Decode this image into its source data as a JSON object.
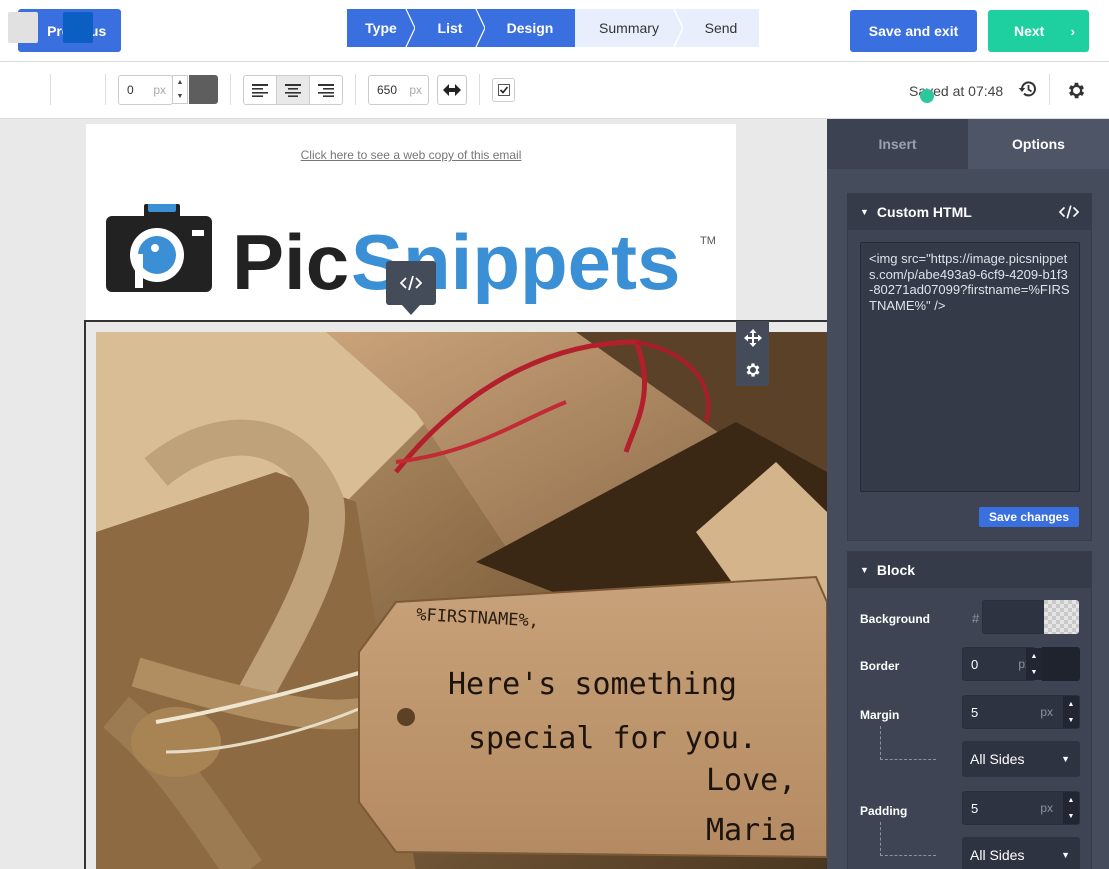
{
  "topbar": {
    "previous_label": "Previous",
    "save_exit_label": "Save and exit",
    "next_label": "Next",
    "steps": [
      {
        "label": "Type",
        "state": "active"
      },
      {
        "label": "List",
        "state": "active"
      },
      {
        "label": "Design",
        "state": "active"
      },
      {
        "label": "Summary",
        "state": "inactive"
      },
      {
        "label": "Send",
        "state": "inactive"
      }
    ]
  },
  "toolbar": {
    "border_value": "0",
    "border_unit": "px",
    "width_value": "650",
    "width_unit": "px",
    "saved_text": "Saved at 07:48",
    "colors": {
      "swatch_grey": "#e1e1e1",
      "swatch_blue": "#0c5fc2",
      "border_color": "#5e5e5e"
    }
  },
  "email": {
    "web_copy_link": "Click here to see a web copy of this email",
    "logo": {
      "part1": "Pic",
      "part2": "Snippets",
      "tm": "TM"
    },
    "tag": {
      "firstname": "%FIRSTNAME%,",
      "line1": "Here's something",
      "line2": "special for you.",
      "line3": "Love,",
      "line4": "Maria"
    }
  },
  "sidebar": {
    "tab_insert": "Insert",
    "tab_options": "Options",
    "custom_html": {
      "title": "Custom HTML",
      "code": "<img src=\"https://image.picsnippets.com/p/abe493a9-6cf9-4209-b1f3-80271ad07099?firstname=%FIRSTNAME%\" />",
      "save_label": "Save changes"
    },
    "block": {
      "title": "Block",
      "background_label": "Background",
      "hash": "#",
      "border_label": "Border",
      "border_value": "0",
      "border_unit": "px",
      "margin_label": "Margin",
      "margin_value": "5",
      "margin_unit": "px",
      "margin_sides": "All Sides",
      "padding_label": "Padding",
      "padding_value": "5",
      "padding_unit": "px",
      "padding_sides": "All Sides"
    }
  }
}
